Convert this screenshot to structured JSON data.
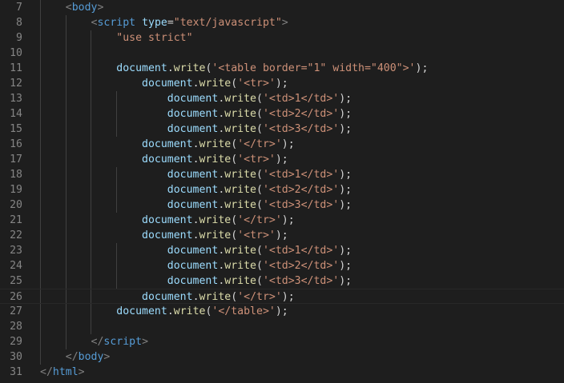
{
  "editor": {
    "colors": {
      "background": "#1e1e1e",
      "line_number": "#858585",
      "tag": "#569cd6",
      "attribute": "#9cdcfe",
      "string": "#ce9178",
      "identifier": "#9cdcfe",
      "function": "#dcdcaa",
      "punctuation": "#d4d4d4",
      "angle_bracket": "#808080"
    },
    "current_line_number": "26",
    "lines": [
      {
        "number": "7",
        "indent": "    ",
        "tokens": [
          {
            "cls": "bracket",
            "text": "<"
          },
          {
            "cls": "tag",
            "text": "body"
          },
          {
            "cls": "bracket",
            "text": ">"
          }
        ]
      },
      {
        "number": "8",
        "indent": "        ",
        "tokens": [
          {
            "cls": "bracket",
            "text": "<"
          },
          {
            "cls": "tag",
            "text": "script"
          },
          {
            "cls": "punc",
            "text": " "
          },
          {
            "cls": "attr",
            "text": "type"
          },
          {
            "cls": "punc",
            "text": "="
          },
          {
            "cls": "str",
            "text": "\"text/javascript\""
          },
          {
            "cls": "bracket",
            "text": ">"
          }
        ]
      },
      {
        "number": "9",
        "indent": "            ",
        "tokens": [
          {
            "cls": "str",
            "text": "\"use strict\""
          }
        ]
      },
      {
        "number": "10",
        "indent": "",
        "tokens": []
      },
      {
        "number": "11",
        "indent": "            ",
        "tokens": [
          {
            "cls": "ident",
            "text": "document"
          },
          {
            "cls": "punc",
            "text": "."
          },
          {
            "cls": "func",
            "text": "write"
          },
          {
            "cls": "punc",
            "text": "("
          },
          {
            "cls": "str",
            "text": "'<table border=\"1\" width=\"400\">'"
          },
          {
            "cls": "punc",
            "text": ");"
          }
        ]
      },
      {
        "number": "12",
        "indent": "                ",
        "tokens": [
          {
            "cls": "ident",
            "text": "document"
          },
          {
            "cls": "punc",
            "text": "."
          },
          {
            "cls": "func",
            "text": "write"
          },
          {
            "cls": "punc",
            "text": "("
          },
          {
            "cls": "str",
            "text": "'<tr>'"
          },
          {
            "cls": "punc",
            "text": ");"
          }
        ]
      },
      {
        "number": "13",
        "indent": "                    ",
        "tokens": [
          {
            "cls": "ident",
            "text": "document"
          },
          {
            "cls": "punc",
            "text": "."
          },
          {
            "cls": "func",
            "text": "write"
          },
          {
            "cls": "punc",
            "text": "("
          },
          {
            "cls": "str",
            "text": "'<td>1</td>'"
          },
          {
            "cls": "punc",
            "text": ");"
          }
        ]
      },
      {
        "number": "14",
        "indent": "                    ",
        "tokens": [
          {
            "cls": "ident",
            "text": "document"
          },
          {
            "cls": "punc",
            "text": "."
          },
          {
            "cls": "func",
            "text": "write"
          },
          {
            "cls": "punc",
            "text": "("
          },
          {
            "cls": "str",
            "text": "'<td>2</td>'"
          },
          {
            "cls": "punc",
            "text": ");"
          }
        ]
      },
      {
        "number": "15",
        "indent": "                    ",
        "tokens": [
          {
            "cls": "ident",
            "text": "document"
          },
          {
            "cls": "punc",
            "text": "."
          },
          {
            "cls": "func",
            "text": "write"
          },
          {
            "cls": "punc",
            "text": "("
          },
          {
            "cls": "str",
            "text": "'<td>3</td>'"
          },
          {
            "cls": "punc",
            "text": ");"
          }
        ]
      },
      {
        "number": "16",
        "indent": "                ",
        "tokens": [
          {
            "cls": "ident",
            "text": "document"
          },
          {
            "cls": "punc",
            "text": "."
          },
          {
            "cls": "func",
            "text": "write"
          },
          {
            "cls": "punc",
            "text": "("
          },
          {
            "cls": "str",
            "text": "'</tr>'"
          },
          {
            "cls": "punc",
            "text": ");"
          }
        ]
      },
      {
        "number": "17",
        "indent": "                ",
        "tokens": [
          {
            "cls": "ident",
            "text": "document"
          },
          {
            "cls": "punc",
            "text": "."
          },
          {
            "cls": "func",
            "text": "write"
          },
          {
            "cls": "punc",
            "text": "("
          },
          {
            "cls": "str",
            "text": "'<tr>'"
          },
          {
            "cls": "punc",
            "text": ");"
          }
        ]
      },
      {
        "number": "18",
        "indent": "                    ",
        "tokens": [
          {
            "cls": "ident",
            "text": "document"
          },
          {
            "cls": "punc",
            "text": "."
          },
          {
            "cls": "func",
            "text": "write"
          },
          {
            "cls": "punc",
            "text": "("
          },
          {
            "cls": "str",
            "text": "'<td>1</td>'"
          },
          {
            "cls": "punc",
            "text": ");"
          }
        ]
      },
      {
        "number": "19",
        "indent": "                    ",
        "tokens": [
          {
            "cls": "ident",
            "text": "document"
          },
          {
            "cls": "punc",
            "text": "."
          },
          {
            "cls": "func",
            "text": "write"
          },
          {
            "cls": "punc",
            "text": "("
          },
          {
            "cls": "str",
            "text": "'<td>2</td>'"
          },
          {
            "cls": "punc",
            "text": ");"
          }
        ]
      },
      {
        "number": "20",
        "indent": "                    ",
        "tokens": [
          {
            "cls": "ident",
            "text": "document"
          },
          {
            "cls": "punc",
            "text": "."
          },
          {
            "cls": "func",
            "text": "write"
          },
          {
            "cls": "punc",
            "text": "("
          },
          {
            "cls": "str",
            "text": "'<td>3</td>'"
          },
          {
            "cls": "punc",
            "text": ");"
          }
        ]
      },
      {
        "number": "21",
        "indent": "                ",
        "tokens": [
          {
            "cls": "ident",
            "text": "document"
          },
          {
            "cls": "punc",
            "text": "."
          },
          {
            "cls": "func",
            "text": "write"
          },
          {
            "cls": "punc",
            "text": "("
          },
          {
            "cls": "str",
            "text": "'</tr>'"
          },
          {
            "cls": "punc",
            "text": ");"
          }
        ]
      },
      {
        "number": "22",
        "indent": "                ",
        "tokens": [
          {
            "cls": "ident",
            "text": "document"
          },
          {
            "cls": "punc",
            "text": "."
          },
          {
            "cls": "func",
            "text": "write"
          },
          {
            "cls": "punc",
            "text": "("
          },
          {
            "cls": "str",
            "text": "'<tr>'"
          },
          {
            "cls": "punc",
            "text": ");"
          }
        ]
      },
      {
        "number": "23",
        "indent": "                    ",
        "tokens": [
          {
            "cls": "ident",
            "text": "document"
          },
          {
            "cls": "punc",
            "text": "."
          },
          {
            "cls": "func",
            "text": "write"
          },
          {
            "cls": "punc",
            "text": "("
          },
          {
            "cls": "str",
            "text": "'<td>1</td>'"
          },
          {
            "cls": "punc",
            "text": ");"
          }
        ]
      },
      {
        "number": "24",
        "indent": "                    ",
        "tokens": [
          {
            "cls": "ident",
            "text": "document"
          },
          {
            "cls": "punc",
            "text": "."
          },
          {
            "cls": "func",
            "text": "write"
          },
          {
            "cls": "punc",
            "text": "("
          },
          {
            "cls": "str",
            "text": "'<td>2</td>'"
          },
          {
            "cls": "punc",
            "text": ");"
          }
        ]
      },
      {
        "number": "25",
        "indent": "                    ",
        "tokens": [
          {
            "cls": "ident",
            "text": "document"
          },
          {
            "cls": "punc",
            "text": "."
          },
          {
            "cls": "func",
            "text": "write"
          },
          {
            "cls": "punc",
            "text": "("
          },
          {
            "cls": "str",
            "text": "'<td>3</td>'"
          },
          {
            "cls": "punc",
            "text": ");"
          }
        ]
      },
      {
        "number": "26",
        "indent": "                ",
        "tokens": [
          {
            "cls": "ident",
            "text": "document"
          },
          {
            "cls": "punc",
            "text": "."
          },
          {
            "cls": "func",
            "text": "write"
          },
          {
            "cls": "punc",
            "text": "("
          },
          {
            "cls": "str",
            "text": "'</tr>'"
          },
          {
            "cls": "punc",
            "text": ");"
          }
        ]
      },
      {
        "number": "27",
        "indent": "            ",
        "tokens": [
          {
            "cls": "ident",
            "text": "document"
          },
          {
            "cls": "punc",
            "text": "."
          },
          {
            "cls": "func",
            "text": "write"
          },
          {
            "cls": "punc",
            "text": "("
          },
          {
            "cls": "str",
            "text": "'</table>'"
          },
          {
            "cls": "punc",
            "text": ");"
          }
        ]
      },
      {
        "number": "28",
        "indent": "",
        "tokens": []
      },
      {
        "number": "29",
        "indent": "        ",
        "tokens": [
          {
            "cls": "bracket",
            "text": "</"
          },
          {
            "cls": "tag",
            "text": "script"
          },
          {
            "cls": "bracket",
            "text": ">"
          }
        ]
      },
      {
        "number": "30",
        "indent": "    ",
        "tokens": [
          {
            "cls": "bracket",
            "text": "</"
          },
          {
            "cls": "tag",
            "text": "body"
          },
          {
            "cls": "bracket",
            "text": ">"
          }
        ]
      },
      {
        "number": "31",
        "indent": "",
        "tokens": [
          {
            "cls": "bracket",
            "text": "</"
          },
          {
            "cls": "tag",
            "text": "html"
          },
          {
            "cls": "bracket",
            "text": ">"
          }
        ]
      }
    ]
  }
}
